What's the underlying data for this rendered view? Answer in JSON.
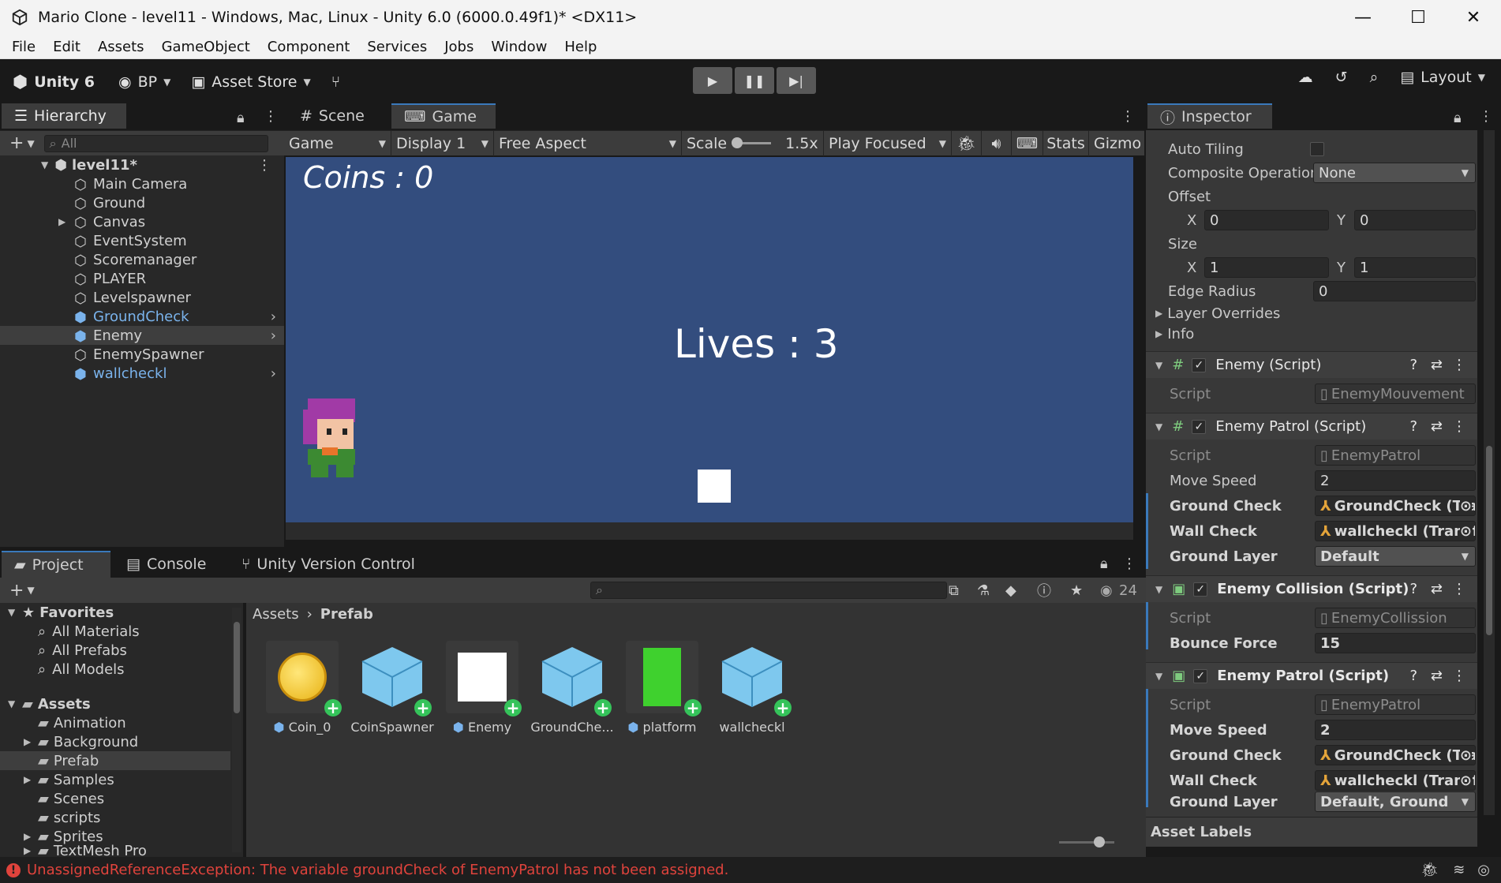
{
  "window": {
    "title": "Mario Clone - level11 - Windows, Mac, Linux - Unity 6.0 (6000.0.49f1)* <DX11>"
  },
  "menu": [
    "File",
    "Edit",
    "Assets",
    "GameObject",
    "Component",
    "Services",
    "Jobs",
    "Window",
    "Help"
  ],
  "toolbar": {
    "unity_label": "Unity 6",
    "account": "BP",
    "asset_store": "Asset Store",
    "layout": "Layout"
  },
  "hierarchy": {
    "tab": "Hierarchy",
    "search_placeholder": "All",
    "scene": "level11*",
    "items": [
      {
        "label": "Main Camera"
      },
      {
        "label": "Ground"
      },
      {
        "label": "Canvas"
      },
      {
        "label": "EventSystem"
      },
      {
        "label": "Scoremanager"
      },
      {
        "label": "PLAYER"
      },
      {
        "label": "Levelspawner"
      },
      {
        "label": "GroundCheck"
      },
      {
        "label": "Enemy"
      },
      {
        "label": "EnemySpawner"
      },
      {
        "label": "wallcheckl"
      }
    ]
  },
  "game": {
    "tabs": [
      "Scene",
      "Game"
    ],
    "mode": "Game",
    "display": "Display 1",
    "aspect": "Free Aspect",
    "scale_label": "Scale",
    "scale_value": "1.5x",
    "play_focus": "Play Focused",
    "stats": "Stats",
    "gizmos": "Gizmo",
    "coins_text": "Coins : 0",
    "lives_text": "Lives : 3"
  },
  "inspector": {
    "tab": "Inspector",
    "auto_tiling": "Auto Tiling",
    "composite_label": "Composite Operation",
    "composite_value": "None",
    "offset_label": "Offset",
    "offset_x": "0",
    "offset_y": "0",
    "size_label": "Size",
    "size_x": "1",
    "size_y": "1",
    "axis_x": "X",
    "axis_y": "Y",
    "edge_radius_label": "Edge Radius",
    "edge_radius": "0",
    "layer_overrides": "Layer Overrides",
    "info": "Info",
    "script_label": "Script",
    "move_speed_label": "Move Speed",
    "ground_check_label": "Ground Check",
    "wall_check_label": "Wall Check",
    "ground_layer_label": "Ground Layer",
    "bounce_force_label": "Bounce Force",
    "c1": {
      "title": "Enemy (Script)",
      "script": "EnemyMouvement"
    },
    "c2": {
      "title": "Enemy Patrol (Script)",
      "script": "EnemyPatrol",
      "move_speed": "2",
      "ground_check": "GroundCheck (Tra",
      "wall_check": "wallcheckl (Transf",
      "ground_layer": "Default"
    },
    "c3": {
      "title": "Enemy Collision (Script)",
      "script": "EnemyCollission",
      "bounce_force": "15"
    },
    "c4": {
      "title": "Enemy Patrol (Script)",
      "script": "EnemyPatrol",
      "move_speed": "2",
      "ground_check": "GroundCheck (Tra",
      "wall_check": "wallcheckl (Transf",
      "ground_layer": "Default, Ground"
    },
    "asset_labels": "Asset Labels"
  },
  "project": {
    "tabs": [
      "Project",
      "Console",
      "Unity Version Control"
    ],
    "count": "24",
    "favorites": "Favorites",
    "fav_items": [
      "All Materials",
      "All Prefabs",
      "All Models"
    ],
    "assets_root": "Assets",
    "folders": [
      "Animation",
      "Background",
      "Prefab",
      "Samples",
      "Scenes",
      "scripts",
      "Sprites",
      "TextMesh Pro"
    ],
    "breadcrumb": [
      "Assets",
      "Prefab"
    ],
    "assets": [
      {
        "label": "Coin_0"
      },
      {
        "label": "CoinSpawner"
      },
      {
        "label": "Enemy"
      },
      {
        "label": "GroundChe..."
      },
      {
        "label": "platform"
      },
      {
        "label": "wallcheckl"
      }
    ]
  },
  "status": {
    "message": "UnassignedReferenceException: The variable groundCheck of EnemyPatrol has not been assigned."
  },
  "colors": {
    "accent": "#3a79bb",
    "game_bg": "#334d7e",
    "error": "#e0433c",
    "prefab_blue": "#7ab3ec"
  }
}
